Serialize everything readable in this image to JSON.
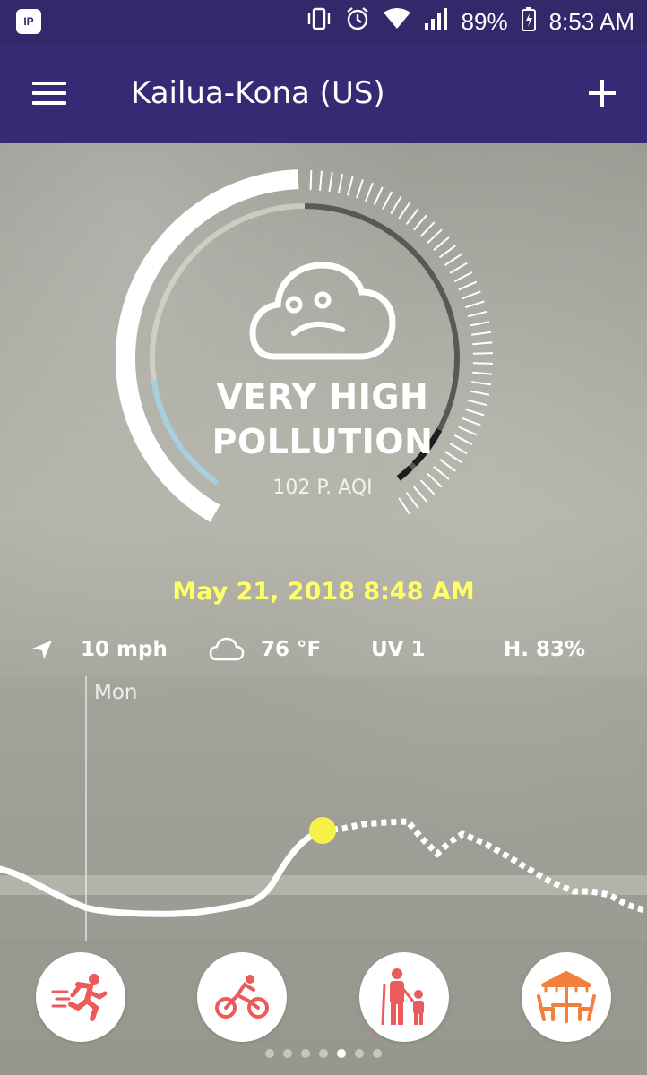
{
  "status_bar": {
    "app_badge": "IP",
    "battery": "89%",
    "time": "8:53 AM"
  },
  "header": {
    "title": "Kailua-Kona (US)"
  },
  "air_quality": {
    "status": "VERY HIGH POLLUTION",
    "status_line1": "VERY HIGH",
    "status_line2": "POLLUTION",
    "aqi": "102 P. AQI",
    "updated": "May 21, 2018 8:48 AM",
    "face": "sad-cloud-icon"
  },
  "metrics": {
    "wind": "10 mph",
    "temperature": "76 °F",
    "uv": "UV 1",
    "humidity": "H. 83%"
  },
  "forecast_chart": {
    "day_label": "Mon"
  },
  "activities": [
    {
      "name": "running",
      "icon": "runner-icon"
    },
    {
      "name": "cycling",
      "icon": "cyclist-icon"
    },
    {
      "name": "elderly-and-children",
      "icon": "family-icon"
    },
    {
      "name": "outdoor-dining",
      "icon": "parasol-table-icon"
    }
  ],
  "pager": {
    "count": 7,
    "active_index": 4
  },
  "colors": {
    "header": "#372973",
    "timestamp": "#ffff66",
    "activity_icon": "#ec5b5b",
    "dining_icon": "#f0803c",
    "current_point": "#f6f04a"
  }
}
